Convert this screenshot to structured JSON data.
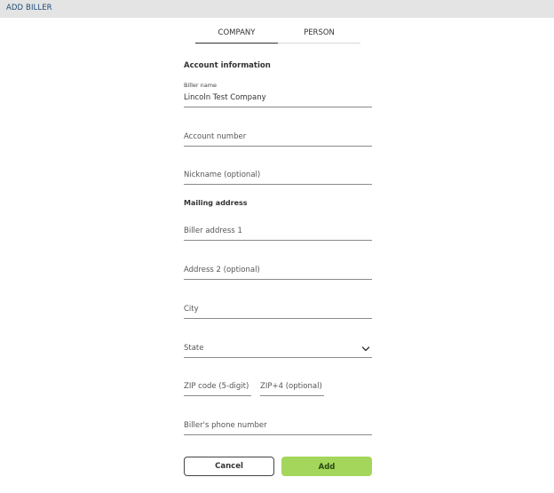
{
  "header": {
    "title": "ADD BILLER"
  },
  "tabs": [
    {
      "label": "COMPANY",
      "active": true
    },
    {
      "label": "PERSON",
      "active": false
    }
  ],
  "account_section": {
    "title": "Account information"
  },
  "fields": {
    "biller_name": {
      "label": "Biller name",
      "value": "Lincoln Test Company"
    },
    "account_number": {
      "placeholder": "Account number"
    },
    "nickname": {
      "placeholder": "Nickname (optional)"
    },
    "biller_address_1": {
      "placeholder": "Biller address 1"
    },
    "address_2": {
      "placeholder": "Address 2 (optional)"
    },
    "city": {
      "placeholder": "City"
    },
    "state": {
      "placeholder": "State"
    },
    "zip": {
      "placeholder": "ZIP code (5-digit)"
    },
    "zip4": {
      "placeholder": "ZIP+4 (optional)"
    },
    "phone": {
      "placeholder": "Biller's phone number"
    }
  },
  "mailing_section": {
    "title": "Mailing address"
  },
  "buttons": {
    "cancel": "Cancel",
    "add": "Add"
  },
  "colors": {
    "header_bg": "#e4e4e4",
    "header_text": "#1e4b7a",
    "add_button": "#a3d65a"
  }
}
